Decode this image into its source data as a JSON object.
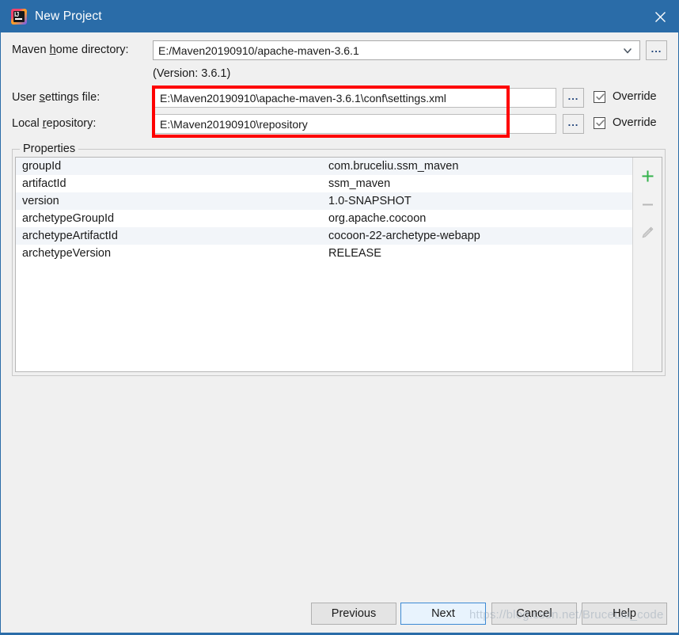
{
  "window": {
    "title": "New Project",
    "app_icon": "intellij-idea-icon",
    "close_icon": "close-icon",
    "titlebar_color": "#2a6ca8",
    "background_color": "#f0f0f0"
  },
  "form": {
    "maven_home": {
      "label_pre": "Maven ",
      "label_mnemonic": "h",
      "label_post": "ome directory:",
      "value": "E:/Maven20190910/apache-maven-3.6.1",
      "dropdown_icon": "chevron-down-icon",
      "browse_label": "...",
      "version_note": "(Version: 3.6.1)"
    },
    "user_settings": {
      "label_pre": "User ",
      "label_mnemonic": "s",
      "label_post": "ettings file:",
      "value": "E:\\Maven20190910\\apache-maven-3.6.1\\conf\\settings.xml",
      "browse_label": "...",
      "override_label": "Override",
      "override_checked": true
    },
    "local_repository": {
      "label_pre": "Local ",
      "label_mnemonic": "r",
      "label_post": "epository:",
      "value": "E:\\Maven20190910\\repository",
      "browse_label": "...",
      "override_label": "Override",
      "override_checked": true
    },
    "highlight_color": "#fe0000"
  },
  "properties": {
    "group_title": "Properties",
    "rows": [
      {
        "key": "groupId",
        "value": "com.bruceliu.ssm_maven"
      },
      {
        "key": "artifactId",
        "value": "ssm_maven"
      },
      {
        "key": "version",
        "value": "1.0-SNAPSHOT"
      },
      {
        "key": "archetypeGroupId",
        "value": "org.apache.cocoon"
      },
      {
        "key": "archetypeArtifactId",
        "value": "cocoon-22-archetype-webapp"
      },
      {
        "key": "archetypeVersion",
        "value": "RELEASE"
      }
    ],
    "toolbar": {
      "add_icon": "plus-icon",
      "add_color": "#33b24b",
      "remove_icon": "minus-icon",
      "remove_color": "#b8b8b8",
      "edit_icon": "pencil-icon",
      "edit_color": "#c2c2c2"
    }
  },
  "footer": {
    "previous_label": "Previous",
    "next_label": "Next",
    "cancel_label": "Cancel",
    "help_label": "Help"
  },
  "watermark": {
    "text": "https://blog.csdn.net/BruceLiu_code"
  }
}
